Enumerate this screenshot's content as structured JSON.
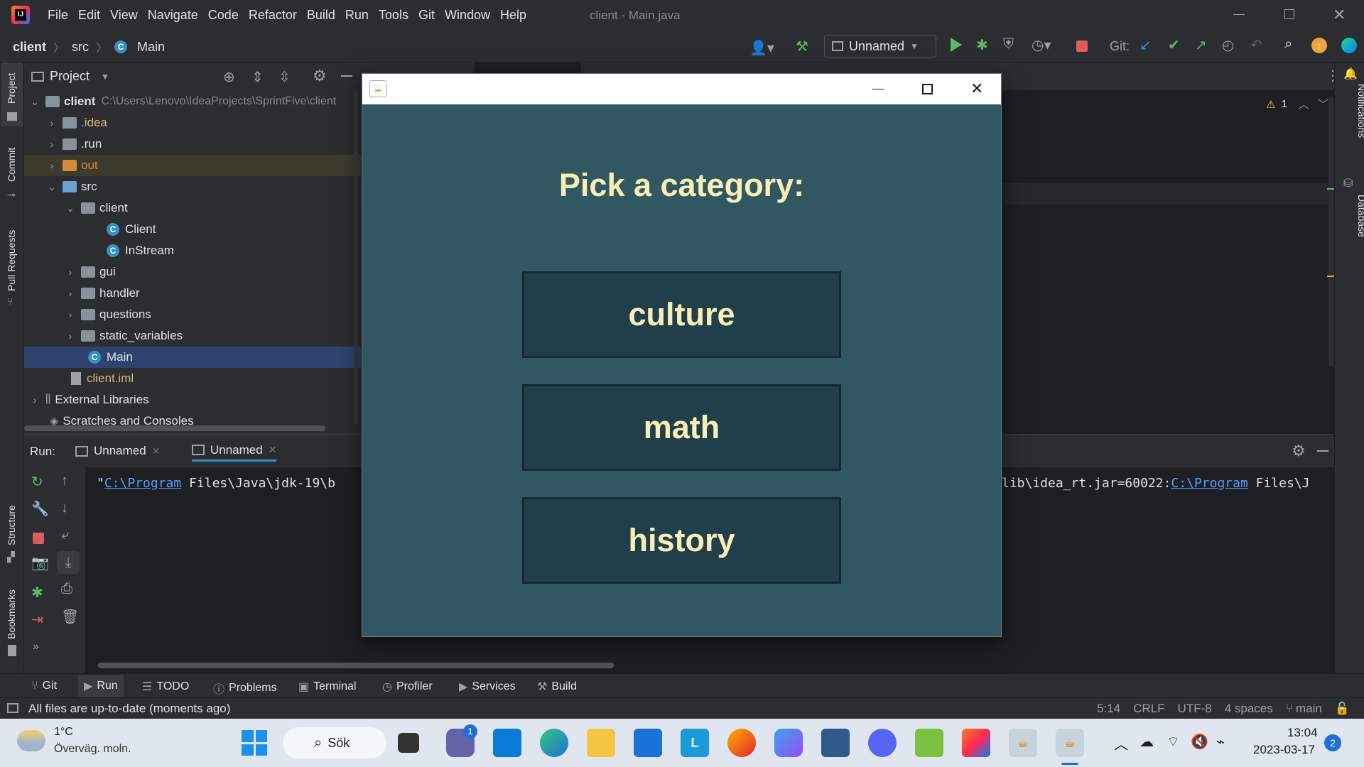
{
  "titlebar": {
    "menu": [
      "File",
      "Edit",
      "View",
      "Navigate",
      "Code",
      "Refactor",
      "Build",
      "Run",
      "Tools",
      "Git",
      "Window",
      "Help"
    ],
    "window_title": "client - Main.java"
  },
  "navbar": {
    "breadcrumb": [
      "client",
      "src",
      "Main"
    ],
    "run_config": "Unnamed",
    "git_label": "Git:"
  },
  "left_strip": {
    "project": "Project",
    "commit": "Commit",
    "pull_requests": "Pull Requests",
    "structure": "Structure",
    "bookmarks": "Bookmarks"
  },
  "right_strip": {
    "notifications": "Notifications",
    "database": "Database"
  },
  "project": {
    "header": "Project",
    "root_name": "client",
    "root_path": "C:\\Users\\Lenovo\\IdeaProjects\\SprintFive\\client",
    "items": [
      ".idea",
      ".run",
      "out",
      "src",
      "client",
      "Client",
      "InStream",
      "gui",
      "handler",
      "questions",
      "static_variables",
      "Main",
      "client.iml",
      "External Libraries",
      "Scratches and Consoles"
    ]
  },
  "editor": {
    "warnings": "1"
  },
  "run": {
    "label": "Run:",
    "tabs": [
      "Unnamed",
      "Unnamed"
    ],
    "console": {
      "quote": "\"",
      "link1": "C:\\Program",
      "text1": " Files\\Java\\jdk-19\\b",
      "text2": "lib\\idea_rt.jar=60022:",
      "link2": "C:\\Program",
      "text3": " Files\\J"
    }
  },
  "bottom_tools": [
    "Git",
    "Run",
    "TODO",
    "Problems",
    "Terminal",
    "Profiler",
    "Services",
    "Build"
  ],
  "statusbar": {
    "message": "All files are up-to-date (moments ago)",
    "position": "5:14",
    "line_sep": "CRLF",
    "encoding": "UTF-8",
    "indent": "4 spaces",
    "branch": "main"
  },
  "java_window": {
    "heading": "Pick a category:",
    "categories": [
      "culture",
      "math",
      "history"
    ]
  },
  "taskbar": {
    "weather_temp": "1°C",
    "weather_desc": "Överväg. moln.",
    "search": "Sök",
    "teams_badge": "1",
    "time": "13:04",
    "date": "2023-03-17",
    "notif_count": "2"
  },
  "colors": {
    "accent": "#3592c4",
    "java_bg": "#315862",
    "java_btn": "#213f4a",
    "java_text": "#f8efb8"
  }
}
